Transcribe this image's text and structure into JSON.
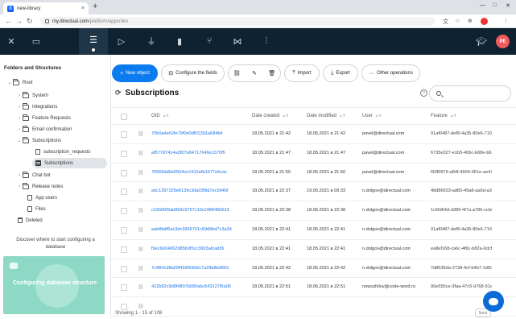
{
  "browser": {
    "tab_title": "new-library",
    "tab_favicon_letter": "D",
    "url_host": "my.directual.com",
    "url_path": "/platform/apps/dev"
  },
  "appbar": {
    "icons": [
      "close-icon",
      "display-icon",
      "database-icon",
      "play-icon",
      "plug-icon",
      "analytics-icon",
      "hierarchy-icon",
      "network-icon",
      "settings-sliders-icon"
    ],
    "user_initials": "PE",
    "active_icon": "database-icon"
  },
  "sidebar": {
    "title": "Folders and Structures",
    "tree": [
      {
        "label": "Root",
        "type": "folder",
        "expanded": true,
        "level": 0
      },
      {
        "label": "System",
        "type": "folder",
        "level": 1
      },
      {
        "label": "Integrations",
        "type": "folder",
        "level": 1
      },
      {
        "label": "Feature Requests",
        "type": "folder",
        "level": 1
      },
      {
        "label": "Email confirmation",
        "type": "folder",
        "level": 1
      },
      {
        "label": "Subscriptions",
        "type": "folder",
        "expanded": true,
        "level": 1
      },
      {
        "label": "subscription_requests",
        "type": "doc",
        "level": 2
      },
      {
        "label": "Subscriptions",
        "type": "db",
        "level": 2,
        "selected": true
      },
      {
        "label": "Chat bot",
        "type": "folder",
        "level": 1
      },
      {
        "label": "Release notes",
        "type": "folder",
        "level": 1
      },
      {
        "label": "App users",
        "type": "doc",
        "level": 1
      },
      {
        "label": "Files",
        "type": "doc",
        "level": 1
      },
      {
        "label": "Deleted",
        "type": "trash",
        "level": 0
      }
    ],
    "discover_text": "Discover where to start configuring a database",
    "promo_title": "Configuring database structure"
  },
  "toolbar": {
    "new_object": "New object",
    "configure_fields": "Configure the fields",
    "import": "Import",
    "export": "Export",
    "other_operations": "Other operations"
  },
  "page": {
    "title": "Subscriptions",
    "search_placeholder": ""
  },
  "table": {
    "columns": [
      "OID",
      "Date created",
      "Date modified",
      "User",
      "Feature"
    ],
    "rows": [
      [
        "70b0a4e62fe79f0e0df01391a684b4",
        "18.05.2021 в 21:42",
        "18.05.2021 в 21:42",
        "pavel@directual.com",
        "91af0487-def8-4a35-80e6-7103c56"
      ],
      [
        "af577d7414a2f07a94717646e1370f5",
        "18.05.2021 в 21:47",
        "18.05.2021 в 21:47",
        "pavel@directual.com",
        "6735e327-e1b5-406c-b68e-b6bb32f"
      ],
      [
        "75666dd0e0504ce1912efb1677e6cac",
        "18.05.2021 в 21:50",
        "18.05.2021 в 21:50",
        "pavel@directual.com",
        "f33f0979-a84f-4904-951e-ae41e52a"
      ],
      [
        "a0c1397329e8139c3da03f9d7ec9945f",
        "18.05.2021 в 22:37",
        "19.05.2021 в 09:33",
        "n.dolgov@directual.com",
        "48d86933-ad65-49a8-aa6d-a3748cd"
      ],
      [
        "c22bf909ab869c9767c10c248840b523",
        "18.05.2021 в 22:38",
        "18.05.2021 в 22:38",
        "n.dolgov@directual.com",
        "1c5fd64d-d389-4f7a-a786-ccbcdb88"
      ],
      [
        "aab8bdf6ac3dc3966701c69d8bd7c3a34",
        "18.05.2021 в 22:41",
        "18.05.2021 в 22:41",
        "n.dolgov@directual.com",
        "91af0487-def8-4a35-80e6-7103c56"
      ],
      [
        "f9ec6d24062985b0f5cc3993afcad36",
        "18.05.2021 в 22:41",
        "18.05.2021 в 22:41",
        "n.dolgov@directual.com",
        "ea8ef168-ca6c-4f6c-b82a-6dcfb6c4"
      ],
      [
        "7c4841d8a09f456f690d17a29b8b3893",
        "18.05.2021 в 22:42",
        "18.05.2021 в 22:42",
        "n.dolgov@directual.com",
        "7d8635da-2738-4cf-b4b7-1d509616"
      ],
      [
        "422b52c9d9f4807b090abc543127f6a06",
        "18.05.2021 в 22:51",
        "18.05.2021 в 22:51",
        "nowozhilov@code-word.ru",
        "00e555ce-3faa-47c5-9768-91d224a1"
      ],
      [
        "",
        "",
        "",
        "",
        ""
      ]
    ],
    "footer": "Showing 1 - 15 of 108",
    "next_label": "Next"
  }
}
